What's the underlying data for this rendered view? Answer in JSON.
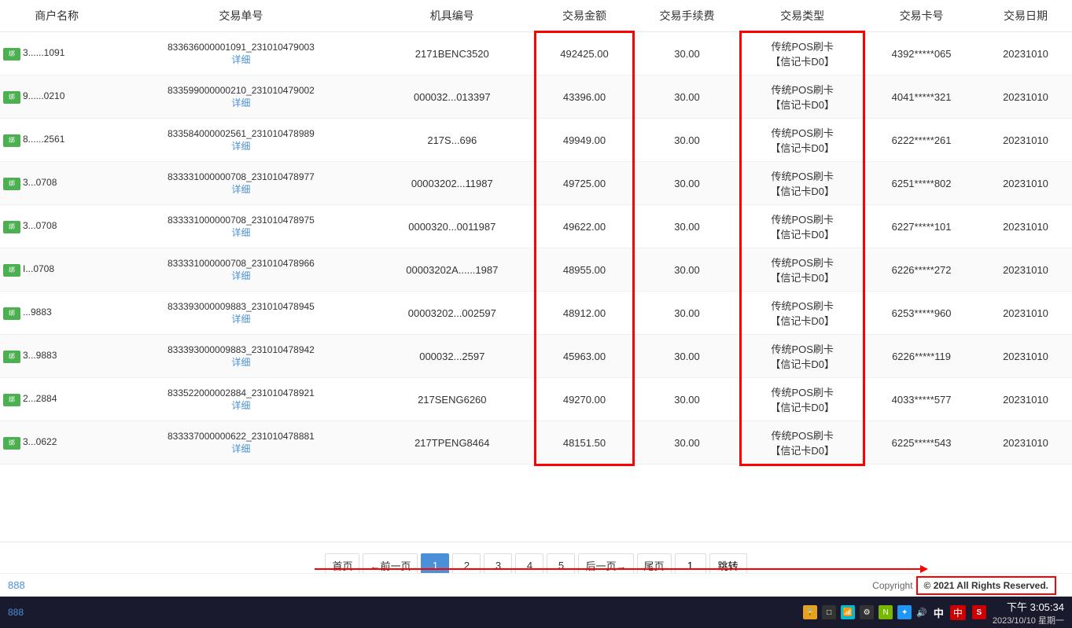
{
  "table": {
    "headers": [
      "商户名称",
      "交易单号",
      "机具编号",
      "交易金额",
      "交易手续费",
      "交易类型",
      "交易卡号",
      "交易日期"
    ],
    "rows": [
      {
        "merchant_thumb": "绑",
        "merchant_name": "3...",
        "merchant_id": "...1091",
        "order_no": "833636000001091_231010479003",
        "order_detail": "详细",
        "device_no": "2171BENC3520",
        "amount": "492425.00",
        "fee": "30.00",
        "type_main": "传统POS刷卡",
        "type_sub": "【信记卡D0】",
        "card_no": "4392*****065",
        "date": "20231010"
      },
      {
        "merchant_thumb": "绑",
        "merchant_name": "9...",
        "merchant_id": "...0210",
        "order_no": "833599000000210_231010479002",
        "order_detail": "详细",
        "device_no": "000032...013397",
        "amount": "43396.00",
        "fee": "30.00",
        "type_main": "传统POS刷卡",
        "type_sub": "【信记卡D0】",
        "card_no": "4041*****321",
        "date": "20231010"
      },
      {
        "merchant_thumb": "绑",
        "merchant_name": "8...",
        "merchant_id": "...2561",
        "order_no": "833584000002561_231010478989",
        "order_detail": "详细",
        "device_no": "217S...696",
        "amount": "49949.00",
        "fee": "30.00",
        "type_main": "传统POS刷卡",
        "type_sub": "【信记卡D0】",
        "card_no": "6222*****261",
        "date": "20231010"
      },
      {
        "merchant_thumb": "绑",
        "merchant_name": "3",
        "merchant_id": "...0708",
        "order_no": "833331000000708_231010478977",
        "order_detail": "详细",
        "device_no": "00003202...11987",
        "amount": "49725.00",
        "fee": "30.00",
        "type_main": "传统POS刷卡",
        "type_sub": "【信记卡D0】",
        "card_no": "6251*****802",
        "date": "20231010"
      },
      {
        "merchant_thumb": "绑",
        "merchant_name": "3",
        "merchant_id": "...0708",
        "order_no": "833331000000708_231010478975",
        "order_detail": "详细",
        "device_no": "0000320...0011987",
        "amount": "49622.00",
        "fee": "30.00",
        "type_main": "传统POS刷卡",
        "type_sub": "【信记卡D0】",
        "card_no": "6227*****101",
        "date": "20231010"
      },
      {
        "merchant_thumb": "绑",
        "merchant_name": "I",
        "merchant_id": "...0708",
        "order_no": "833331000000708_231010478966",
        "order_detail": "详细",
        "device_no": "00003202A......1987",
        "amount": "48955.00",
        "fee": "30.00",
        "type_main": "传统POS刷卡",
        "type_sub": "【信记卡D0】",
        "card_no": "6226*****272",
        "date": "20231010"
      },
      {
        "merchant_thumb": "绑",
        "merchant_name": "",
        "merchant_id": "...9883",
        "order_no": "833393000009883_231010478945",
        "order_detail": "详细",
        "device_no": "00003202...002597",
        "amount": "48912.00",
        "fee": "30.00",
        "type_main": "传统POS刷卡",
        "type_sub": "【信记卡D0】",
        "card_no": "6253*****960",
        "date": "20231010"
      },
      {
        "merchant_thumb": "绑",
        "merchant_name": "3",
        "merchant_id": "...9883",
        "order_no": "833393000009883_231010478942",
        "order_detail": "详细",
        "device_no": "000032...2597",
        "amount": "45963.00",
        "fee": "30.00",
        "type_main": "传统POS刷卡",
        "type_sub": "【信记卡D0】",
        "card_no": "6226*****119",
        "date": "20231010"
      },
      {
        "merchant_thumb": "绑",
        "merchant_name": "2",
        "merchant_id": "...2884",
        "order_no": "833522000002884_231010478921",
        "order_detail": "详细",
        "device_no": "217SENG6260",
        "amount": "49270.00",
        "fee": "30.00",
        "type_main": "传统POS刷卡",
        "type_sub": "【信记卡D0】",
        "card_no": "4033*****577",
        "date": "20231010"
      },
      {
        "merchant_thumb": "绑",
        "merchant_name": "3",
        "merchant_id": "...0622",
        "order_no": "833337000000622_231010478881",
        "order_detail": "详细",
        "device_no": "217TPENG8464",
        "amount": "48151.50",
        "fee": "30.00",
        "type_main": "传统POS刷卡",
        "type_sub": "【信记卡D0】",
        "card_no": "6225*****543",
        "date": "20231010"
      }
    ]
  },
  "pagination": {
    "first": "首页",
    "prev": "←前一页",
    "pages": [
      "1",
      "2",
      "3",
      "4",
      "5"
    ],
    "current_page": "1",
    "next": "后一页→",
    "last": "尾页",
    "jump_value": "1",
    "jump_btn": "跳转"
  },
  "footer": {
    "left_text": "888",
    "copyright": "Copyright",
    "rights": "© 2021 All Rights Reserved."
  },
  "taskbar": {
    "left_text": "888",
    "time": "下午 3:05:34",
    "date": "2023/10/10 星期一"
  }
}
